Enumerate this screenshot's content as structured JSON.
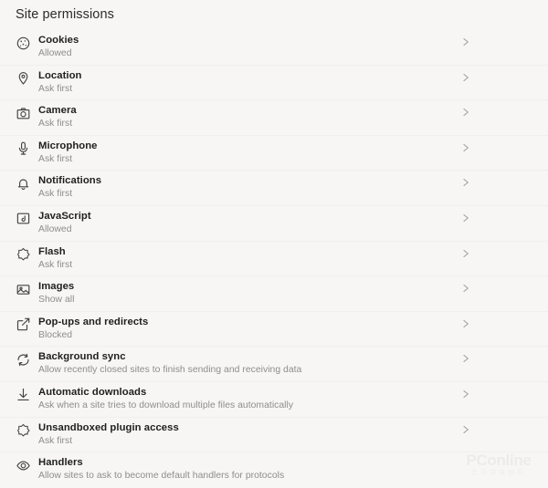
{
  "header": {
    "title": "Site permissions"
  },
  "permissions": {
    "items": [
      {
        "icon": "cookie-icon",
        "label": "Cookies",
        "status": "Allowed",
        "chevron": "chevron-right-icon",
        "has_chevron": true
      },
      {
        "icon": "location-pin-icon",
        "label": "Location",
        "status": "Ask first",
        "chevron": "chevron-right-icon",
        "has_chevron": true
      },
      {
        "icon": "camera-icon",
        "label": "Camera",
        "status": "Ask first",
        "chevron": "chevron-right-icon",
        "has_chevron": true
      },
      {
        "icon": "microphone-icon",
        "label": "Microphone",
        "status": "Ask first",
        "chevron": "chevron-right-icon",
        "has_chevron": true
      },
      {
        "icon": "bell-icon",
        "label": "Notifications",
        "status": "Ask first",
        "chevron": "chevron-right-icon",
        "has_chevron": true
      },
      {
        "icon": "javascript-icon",
        "label": "JavaScript",
        "status": "Allowed",
        "chevron": "chevron-right-icon",
        "has_chevron": true
      },
      {
        "icon": "flash-icon",
        "label": "Flash",
        "status": "Ask first",
        "chevron": "chevron-right-icon",
        "has_chevron": true
      },
      {
        "icon": "image-icon",
        "label": "Images",
        "status": "Show all",
        "chevron": "chevron-right-icon",
        "has_chevron": true
      },
      {
        "icon": "popup-icon",
        "label": "Pop-ups and redirects",
        "status": "Blocked",
        "chevron": "chevron-right-icon",
        "has_chevron": true
      },
      {
        "icon": "sync-icon",
        "label": "Background sync",
        "status": "Allow recently closed sites to finish sending and receiving data",
        "chevron": "chevron-right-icon",
        "has_chevron": true
      },
      {
        "icon": "download-icon",
        "label": "Automatic downloads",
        "status": "Ask when a site tries to download multiple files automatically",
        "chevron": "chevron-right-icon",
        "has_chevron": true
      },
      {
        "icon": "plugin-icon",
        "label": "Unsandboxed plugin access",
        "status": "Ask first",
        "chevron": "chevron-right-icon",
        "has_chevron": true
      },
      {
        "icon": "handlers-icon",
        "label": "Handlers",
        "status": "Allow sites to ask to become default handlers for protocols",
        "chevron": "chevron-right-icon",
        "has_chevron": false
      }
    ]
  },
  "watermark": {
    "main": "PConline",
    "sub": "太平洋电脑网"
  },
  "colors": {
    "background": "#f7f6f5",
    "title": "#2b2b2b",
    "label": "#1f1f1f",
    "status": "#8f8d8b",
    "icon": "#444240",
    "chevron": "#9d9b99",
    "divider": "#f1efee"
  }
}
